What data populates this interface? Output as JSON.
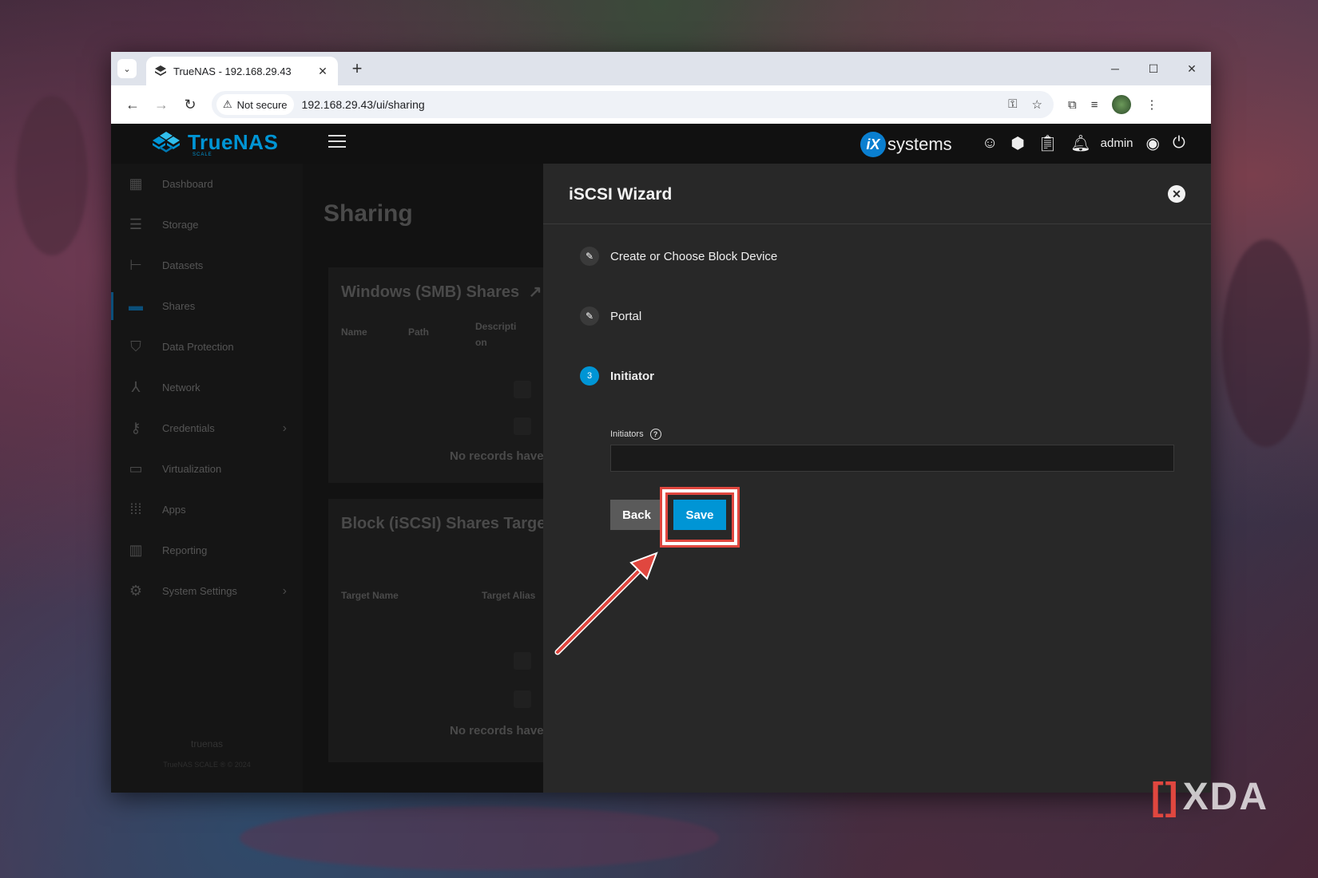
{
  "browser": {
    "tab_title": "TrueNAS - 192.168.29.43",
    "security_label": "Not secure",
    "url": "192.168.29.43/ui/sharing"
  },
  "app": {
    "logo_text": "TrueNAS",
    "logo_sub": "SCALE",
    "vendor_logo_badge": "iX",
    "vendor_logo_text": "systems",
    "user": "admin"
  },
  "sidebar": {
    "items": [
      {
        "label": "Dashboard",
        "icon": "dashboard-icon"
      },
      {
        "label": "Storage",
        "icon": "storage-icon"
      },
      {
        "label": "Datasets",
        "icon": "datasets-icon"
      },
      {
        "label": "Shares",
        "icon": "shares-icon"
      },
      {
        "label": "Data Protection",
        "icon": "shield-icon"
      },
      {
        "label": "Network",
        "icon": "network-icon"
      },
      {
        "label": "Credentials",
        "icon": "key-icon"
      },
      {
        "label": "Virtualization",
        "icon": "laptop-icon"
      },
      {
        "label": "Apps",
        "icon": "apps-grid-icon"
      },
      {
        "label": "Reporting",
        "icon": "chart-icon"
      },
      {
        "label": "System Settings",
        "icon": "gear-icon"
      }
    ],
    "footer_host": "truenas",
    "footer_version": "TrueNAS SCALE ® © 2024"
  },
  "main": {
    "page_title": "Sharing",
    "smb_card": {
      "title": "Windows (SMB) Shares",
      "columns": [
        "Name",
        "Path",
        "Descripti on"
      ],
      "empty": "No records have"
    },
    "iscsi_card": {
      "title": "Block (iSCSI) Shares Target",
      "columns": [
        "Target Name",
        "Target Alias"
      ],
      "empty": "No records have"
    }
  },
  "wizard": {
    "title": "iSCSI Wizard",
    "steps": [
      {
        "label": "Create or Choose Block Device",
        "state": "edit"
      },
      {
        "label": "Portal",
        "state": "edit"
      },
      {
        "label": "Initiator",
        "state": "current",
        "number": "3"
      }
    ],
    "initiators_label": "Initiators",
    "initiators_value": "",
    "back_label": "Back",
    "save_label": "Save"
  },
  "watermark": "XDA",
  "colors": {
    "accent": "#0095d5",
    "highlight": "#e0473f"
  }
}
